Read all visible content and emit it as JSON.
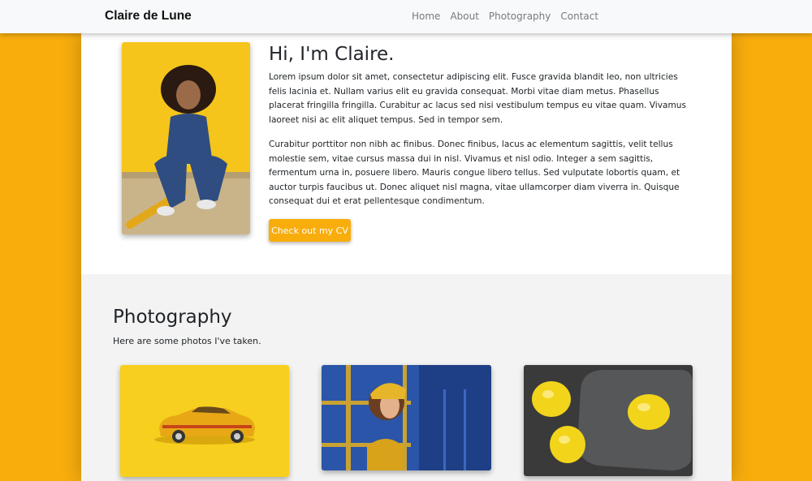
{
  "nav": {
    "brand": "Claire de Lune",
    "links": [
      "Home",
      "About",
      "Photography",
      "Contact"
    ]
  },
  "about": {
    "heading": "Hi, I'm Claire.",
    "paragraph1": "Lorem ipsum dolor sit amet, consectetur adipiscing elit. Fusce gravida blandit leo, non ultricies felis lacinia et. Nullam varius elit eu gravida consequat. Morbi vitae diam metus. Phasellus placerat fringilla fringilla. Curabitur ac lacus sed nisi vestibulum tempus eu vitae quam. Vivamus laoreet nisi ac elit aliquet tempus. Sed in tempor sem.",
    "paragraph2": "Curabitur porttitor non nibh ac finibus. Donec finibus, lacus ac elementum sagittis, velit tellus molestie sem, vitae cursus massa dui in nisl. Vivamus et nisl odio. Integer a sem sagittis, fermentum urna in, posuere libero. Mauris congue libero tellus. Sed vulputate lobortis quam, et auctor turpis faucibus ut. Donec aliquet nisl magna, vitae ullamcorper diam viverra in. Quisque consequat dui et erat pellentesque condimentum.",
    "cv_button": "Check out my CV"
  },
  "photography": {
    "heading": "Photography",
    "subtitle": "Here are some photos I've taken."
  },
  "colors": {
    "accent": "#f8ad0d",
    "navbar_bg": "#f8f9fa",
    "section_bg": "#f3f3f3"
  }
}
